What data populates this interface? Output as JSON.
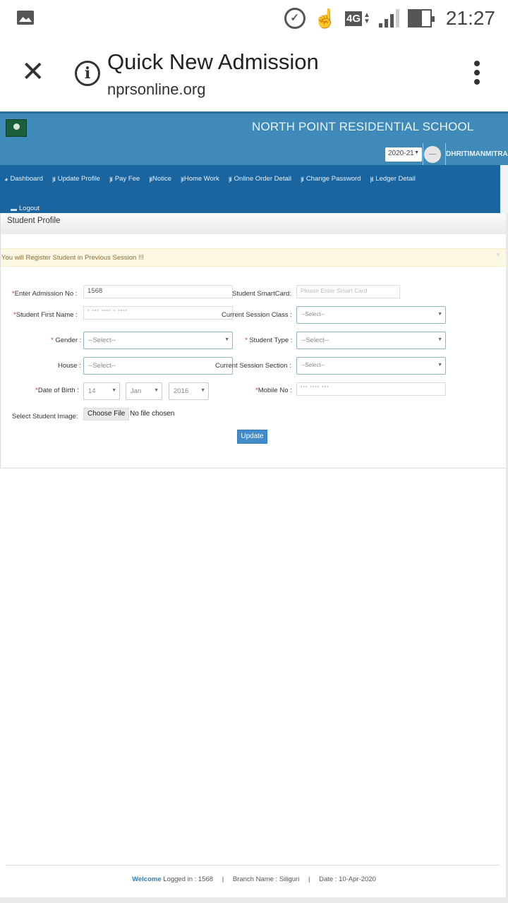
{
  "status_bar": {
    "time": "21:27",
    "network": "4G",
    "icons": [
      "gallery-icon",
      "alarm-icon",
      "touch-icon",
      "network-4g-icon",
      "signal-icon",
      "battery-icon"
    ]
  },
  "browser": {
    "title": "Quick New Admission",
    "url": "nprsonline.org",
    "close_icon": "✕",
    "info_icon": "i"
  },
  "header": {
    "school_name": "NORTH POINT RESIDENTIAL SCHOOL",
    "session": "2020-21",
    "username": "DHRITIMANMITRA",
    "colors": {
      "header_bg": "#3f8ab8",
      "nav_bg": "#1a65a0"
    }
  },
  "nav": {
    "items": [
      {
        "label": "Dashboard",
        "icon": "dashboard-icon",
        "glyph": "◕"
      },
      {
        "label": "Update Profile",
        "icon": "bar-chart-icon",
        "glyph": "|ıl"
      },
      {
        "label": "Pay Fee",
        "icon": "bar-chart-icon",
        "glyph": "|ıl"
      },
      {
        "label": "Notice",
        "icon": "bar-chart-icon",
        "glyph": "|ıl"
      },
      {
        "label": "Home Work",
        "icon": "bar-chart-icon",
        "glyph": "|ıl"
      },
      {
        "label": "Online Order Detail",
        "icon": "bar-chart-icon",
        "glyph": "|ıl"
      },
      {
        "label": "Change Password",
        "icon": "bar-chart-icon",
        "glyph": "|ıl"
      },
      {
        "label": "Ledger Detail",
        "icon": "bar-chart-icon",
        "glyph": "|ıl"
      }
    ],
    "logout": {
      "label": "Logout",
      "icon": "coffee-icon",
      "glyph": "▬"
    }
  },
  "panel": {
    "heading": "Student Profile",
    "alert": "You will Register Student in Previous Session !!!",
    "alert_close": "×"
  },
  "form": {
    "admission_no": {
      "label": "Enter Admission No :",
      "value": "1568"
    },
    "smartcard": {
      "label": "Student SmartCard:",
      "placeholder": "Please Enter  Smart Card"
    },
    "first_name": {
      "label": "Student First Name :",
      "value": "▪ ▪▪▪ ▪▪▪▪ ▪ ▪▪▪▪"
    },
    "session_class": {
      "label": "Current Session Class :",
      "value": "--Select--"
    },
    "gender": {
      "label": "Gender :",
      "value": "--Select--"
    },
    "student_type": {
      "label": "Student Type :",
      "value": "--Select--"
    },
    "house": {
      "label": "House :",
      "value": "--Select--"
    },
    "session_section": {
      "label": "Current Session Section :",
      "value": "--Select--"
    },
    "dob": {
      "label": "Date of Birth :",
      "day": "14",
      "month": "Jan",
      "year": "2016"
    },
    "mobile": {
      "label": "Mobile No :",
      "value": "▪▪▪ ▪▪▪▪ ▪▪▪"
    },
    "image": {
      "label": "Select Student Image:",
      "button": "Choose File",
      "status": "No file chosen"
    },
    "required_mark": "*",
    "update_button": "Update"
  },
  "footer": {
    "welcome": "Welcome",
    "logged_in": "Logged in : 1568",
    "branch": "Branch Name : Siliguri",
    "date": "Date : 10-Apr-2020",
    "separator": "|"
  }
}
